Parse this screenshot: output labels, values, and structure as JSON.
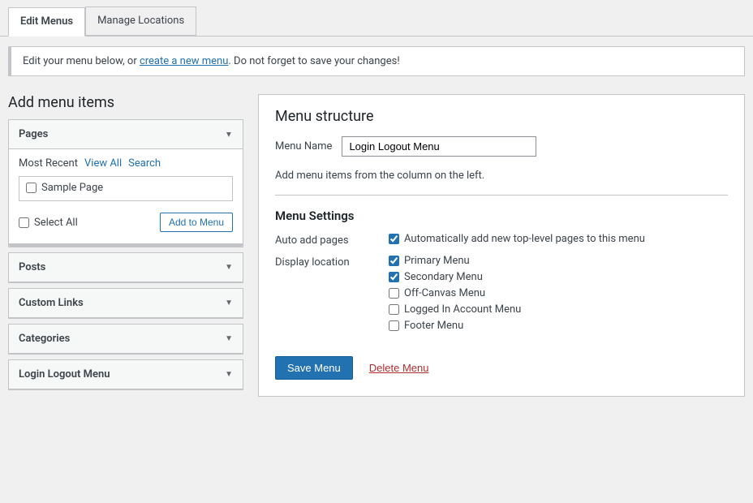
{
  "tabs": [
    {
      "id": "edit-menus",
      "label": "Edit Menus",
      "active": true
    },
    {
      "id": "manage-locations",
      "label": "Manage Locations",
      "active": false
    }
  ],
  "notice": {
    "prefix": "Edit your menu below, or ",
    "link_text": "create a new menu",
    "suffix": ". Do not forget to save your changes!"
  },
  "left_panel": {
    "title": "Add menu items",
    "accordions": [
      {
        "id": "pages",
        "label": "Pages",
        "open": true,
        "sub_tabs": [
          {
            "label": "Most Recent",
            "active": true
          },
          {
            "label": "View All",
            "active": false
          },
          {
            "label": "Search",
            "active": false
          }
        ],
        "items": [
          {
            "label": "Sample Page",
            "checked": false
          }
        ],
        "select_all_label": "Select All",
        "add_button_label": "Add to Menu"
      },
      {
        "id": "posts",
        "label": "Posts",
        "open": false
      },
      {
        "id": "custom-links",
        "label": "Custom Links",
        "open": false
      },
      {
        "id": "categories",
        "label": "Categories",
        "open": false
      },
      {
        "id": "login-logout-menu",
        "label": "Login Logout Menu",
        "open": false
      }
    ]
  },
  "right_panel": {
    "title": "Menu structure",
    "menu_name_label": "Menu Name",
    "menu_name_value": "Login Logout Menu",
    "add_items_text": "Add menu items from the column on the left.",
    "settings_title": "Menu Settings",
    "settings": [
      {
        "label": "Auto add pages",
        "options": [
          {
            "label": "Automatically add new top-level pages to this menu",
            "checked": true
          }
        ]
      },
      {
        "label": "Display location",
        "options": [
          {
            "label": "Primary Menu",
            "checked": true
          },
          {
            "label": "Secondary Menu",
            "checked": true
          },
          {
            "label": "Off-Canvas Menu",
            "checked": false
          },
          {
            "label": "Logged In Account Menu",
            "checked": false
          },
          {
            "label": "Footer Menu",
            "checked": false
          }
        ]
      }
    ],
    "save_button_label": "Save Menu",
    "delete_button_label": "Delete Menu"
  }
}
